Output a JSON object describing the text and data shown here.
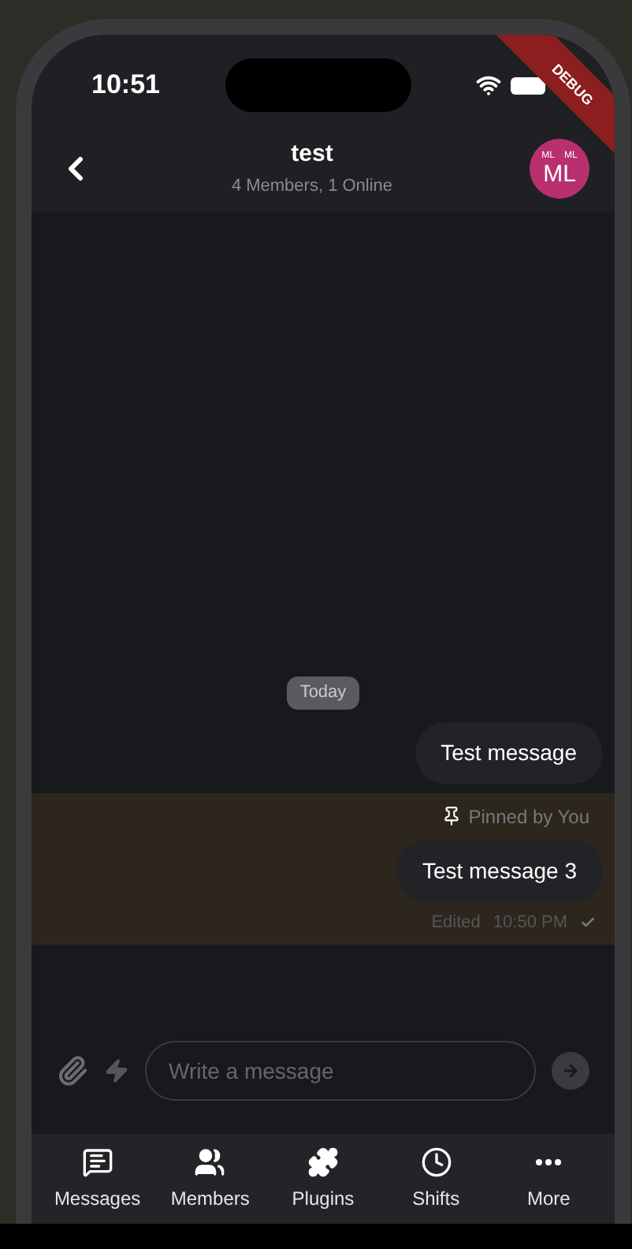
{
  "status_bar": {
    "time": "10:51",
    "debug_banner": "DEBUG"
  },
  "header": {
    "title": "test",
    "subtitle": "4 Members, 1 Online",
    "avatar": {
      "small_initials": [
        "ML",
        "ML"
      ],
      "initials": "ML"
    }
  },
  "date_chip": "Today",
  "messages": [
    {
      "text": "Test message",
      "pinned": false
    },
    {
      "text": "Test message 3",
      "pinned": true,
      "pin_label": "Pinned by You",
      "edited_label": "Edited",
      "time": "10:50 PM",
      "sent": true
    }
  ],
  "composer": {
    "placeholder": "Write a message"
  },
  "tabs": [
    {
      "label": "Messages"
    },
    {
      "label": "Members"
    },
    {
      "label": "Plugins"
    },
    {
      "label": "Shifts"
    },
    {
      "label": "More"
    }
  ]
}
